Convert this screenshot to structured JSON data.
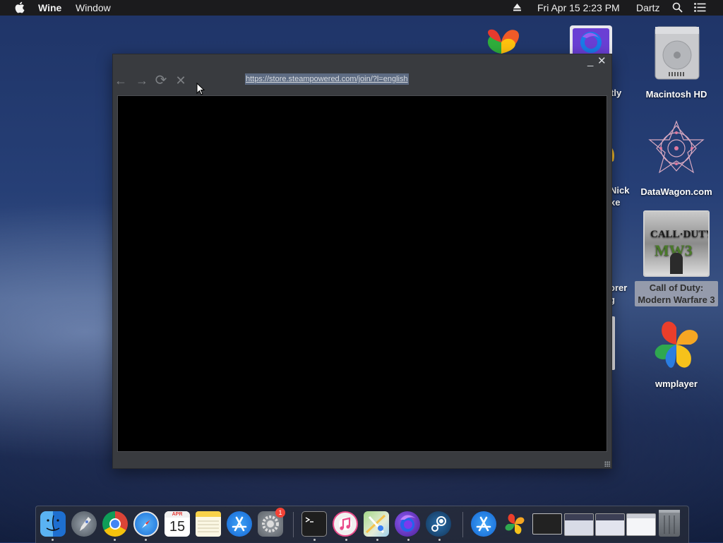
{
  "menubar": {
    "apple_icon": "apple-logo",
    "app_name": "Wine",
    "window_menu": "Window",
    "datetime": "Fri Apr 15  2:23 PM",
    "user": "Dartz"
  },
  "desktop": {
    "icons": [
      {
        "label": "Macintosh HD",
        "icon": "hard-drive-icon"
      },
      {
        "label": "DataWagon.com",
        "icon": "datawagon-icon"
      },
      {
        "label": "Call of Duty: Modern Warfare 3",
        "line1": "Call of Duty:",
        "line2": "Modern Warfare 3",
        "icon": "cod-mw3-icon"
      },
      {
        "label": "wmplayer",
        "icon": "wmplayer-icon"
      }
    ],
    "partial_labels": {
      "a": "tly",
      "b1": "Nick",
      "b2": "xe",
      "c1": "orer",
      "c2": "g"
    }
  },
  "browser": {
    "url": "https://store.steampowered.com/join/?l=english",
    "nav": {
      "back": "←",
      "forward": "→",
      "reload": "⟳",
      "stop": "✕"
    },
    "window_controls": {
      "minimize": "_",
      "close": "✕"
    }
  },
  "dock": {
    "calendar_month": "APR",
    "calendar_day": "15",
    "badge": "1",
    "apps": [
      "finder",
      "launchpad",
      "chrome",
      "safari",
      "calendar",
      "notes",
      "app-store",
      "system-preferences",
      "terminal",
      "itunes",
      "maps",
      "firefox",
      "steam",
      "app-store-2",
      "wmplayer",
      "window-1",
      "window-2",
      "window-3",
      "window-4",
      "trash"
    ]
  }
}
